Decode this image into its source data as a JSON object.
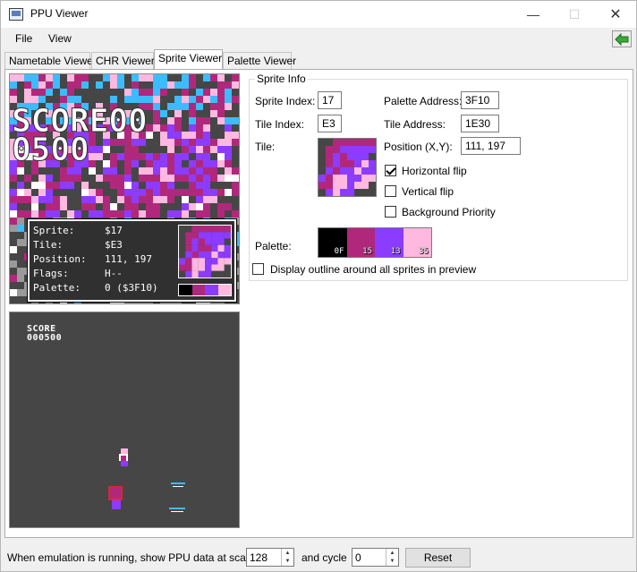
{
  "window": {
    "title": "PPU Viewer"
  },
  "menu": {
    "file": "File",
    "view": "View"
  },
  "tabs": [
    {
      "label": "Nametable Viewer"
    },
    {
      "label": "CHR Viewer"
    },
    {
      "label": "Sprite Viewer"
    },
    {
      "label": "Palette Viewer"
    }
  ],
  "sheet": {
    "text": "SCORE00 0500",
    "overlay": {
      "rows": [
        {
          "key": "Sprite:",
          "val": "$17"
        },
        {
          "key": "Tile:",
          "val": "$E3"
        },
        {
          "key": "Position:",
          "val": "111, 197"
        },
        {
          "key": "Flags:",
          "val": "H--"
        },
        {
          "key": "Palette:",
          "val": "0 ($3F10)"
        }
      ]
    }
  },
  "screen": {
    "score_label": "SCORE",
    "score_value": "000500"
  },
  "sprite_info": {
    "legend": "Sprite Info",
    "sprite_index_label": "Sprite Index:",
    "sprite_index": "17",
    "tile_index_label": "Tile Index:",
    "tile_index": "E3",
    "tile_label": "Tile:",
    "palette_address_label": "Palette Address:",
    "palette_address": "3F10",
    "tile_address_label": "Tile Address:",
    "tile_address": "1E30",
    "position_label": "Position (X,Y):",
    "position": "111, 197",
    "horizontal_flip_label": "Horizontal flip",
    "horizontal_flip": true,
    "vertical_flip_label": "Vertical flip",
    "vertical_flip": false,
    "background_priority_label": "Background Priority",
    "background_priority": false,
    "palette_label": "Palette:",
    "palette": [
      {
        "code": "0F",
        "color": "#000000"
      },
      {
        "code": "15",
        "color": "#b0287c"
      },
      {
        "code": "13",
        "color": "#8c3cff"
      },
      {
        "code": "35",
        "color": "#ffb8e0"
      }
    ]
  },
  "outline_option": {
    "label": "Display outline around all sprites in preview",
    "checked": false
  },
  "bottom": {
    "scanline_label": "When emulation is running, show PPU data at scanline",
    "scanline_value": "128",
    "cycle_label": "and cycle",
    "cycle_value": "0",
    "reset_label": "Reset"
  },
  "colors": {
    "nes_gray": "#464646",
    "pink": "#ffb8e0",
    "magenta": "#b0287c",
    "purple": "#8c3cff",
    "cyan": "#3cbcfc",
    "accent_green": "#3aa83a"
  }
}
